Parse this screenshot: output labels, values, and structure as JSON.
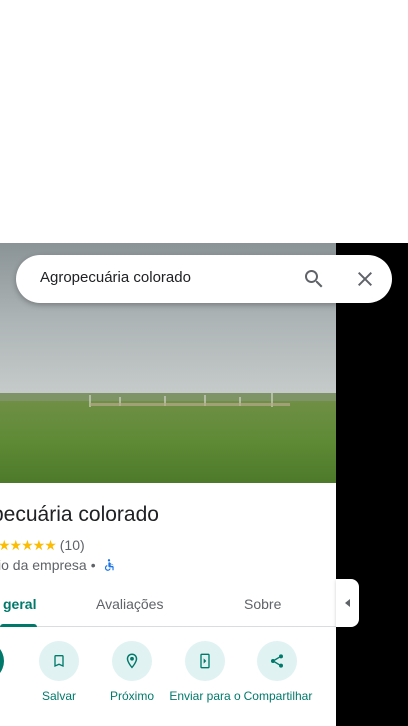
{
  "search": {
    "query": "Agropecuária colorado",
    "search_icon": "search-icon",
    "close_icon": "close-icon"
  },
  "place": {
    "title": "pecuária colorado",
    "stars": "★★★★★",
    "review_count": "(10)",
    "category": "io da empresa",
    "separator": "•",
    "accessibility_icon": "wheelchair-icon"
  },
  "tabs": [
    {
      "label": "geral",
      "selected": true
    },
    {
      "label": "Avaliações",
      "selected": false
    },
    {
      "label": "Sobre",
      "selected": false
    }
  ],
  "actions": [
    {
      "label": "s",
      "icon": "directions-icon"
    },
    {
      "label": "Salvar",
      "icon": "bookmark-icon"
    },
    {
      "label": "Próximo",
      "icon": "nearby-icon"
    },
    {
      "label": "Enviar para o",
      "icon": "send-to-phone-icon"
    },
    {
      "label": "Compartilhar",
      "icon": "share-icon"
    }
  ],
  "colors": {
    "accent": "#00796b",
    "action_bg": "#e0f2f1",
    "star": "#fbbc04",
    "accessibility": "#1a73e8"
  }
}
